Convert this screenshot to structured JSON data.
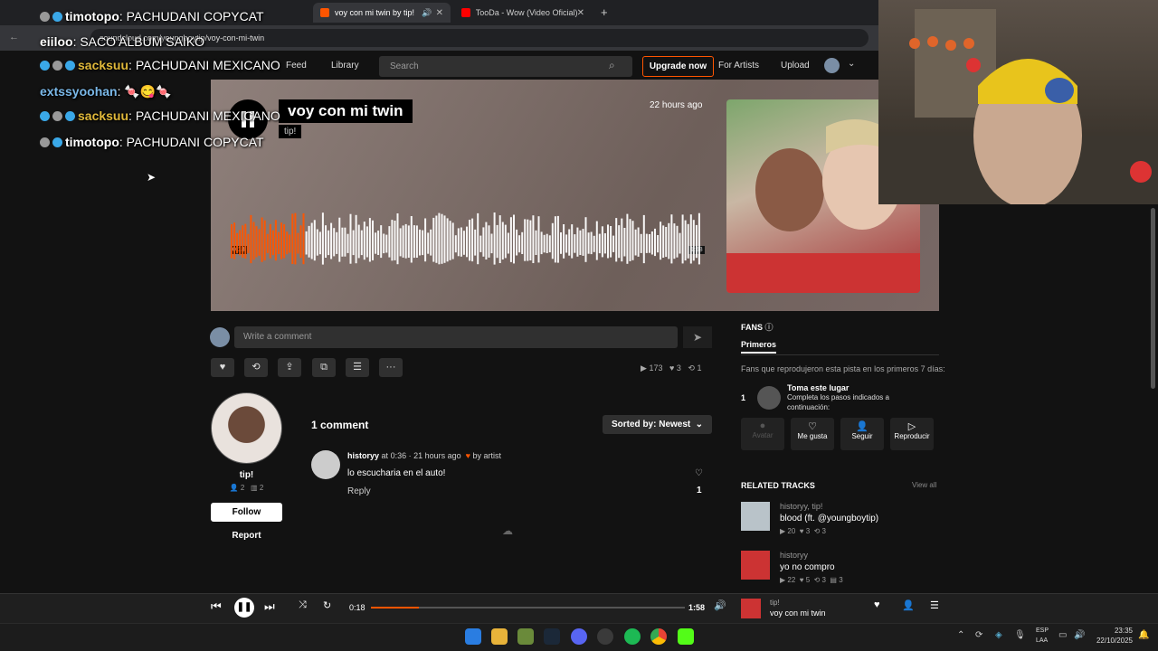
{
  "browser": {
    "tabs": [
      {
        "label": "voy con mi twin by tip!",
        "active": true,
        "favicon_color": "#ff5500"
      },
      {
        "label": "TooDa - Wow (Video Oficial) - Y",
        "active": false,
        "favicon_color": "#ff0000"
      }
    ],
    "new_tab": "+",
    "url": "soundcloud.com/youngboytip/voy-con-mi-twin"
  },
  "nav": {
    "feed": "Feed",
    "library": "Library",
    "search_placeholder": "Search",
    "upgrade": "Upgrade now",
    "for_artists": "For Artists",
    "upload": "Upload"
  },
  "track": {
    "title": "voy con mi twin",
    "artist": "tip!",
    "posted": "22 hours ago",
    "time_current": "0:18",
    "time_total": "1:58",
    "progress": 0.153,
    "accent": "#ff5500"
  },
  "comment_box": {
    "placeholder": "Write a comment",
    "send_icon": "send-icon"
  },
  "stats": {
    "plays": "173",
    "likes": "3",
    "reposts": "1"
  },
  "uploader": {
    "name": "tip!",
    "followers": "2",
    "tracks": "2",
    "follow_label": "Follow",
    "report_label": "Report"
  },
  "comments": {
    "count_label": "1 comment",
    "sort_label": "Sorted by: Newest",
    "items": [
      {
        "user": "historyy",
        "at": "at",
        "timestamp": "0:36",
        "ago": "· 21 hours ago",
        "by_artist": "by artist",
        "text": "lo escucharia en el auto!",
        "reply": "Reply",
        "likes": "1"
      }
    ]
  },
  "fans": {
    "header": "FANS",
    "tab": "Primeros",
    "description": "Fans que reprodujeron esta pista en los primeros 7 días:",
    "rank": "1",
    "slot_title": "Toma este lugar",
    "slot_desc_1": "Completa los pasos indicados a",
    "slot_desc_2": "continuación:",
    "actions": [
      "Avatar",
      "Me gusta",
      "Seguir",
      "Reproducir"
    ]
  },
  "related": {
    "header": "RELATED TRACKS",
    "view_all": "View all",
    "tracks": [
      {
        "artist": "historyy, tip!",
        "title": "blood (ft. @youngboytip)",
        "plays": "20",
        "likes": "3",
        "reposts": "3"
      },
      {
        "artist": "historyy",
        "title": "yo no compro",
        "plays": "22",
        "likes": "5",
        "reposts": "3",
        "comments": "3"
      }
    ]
  },
  "player": {
    "current": "0:18",
    "total": "1:58",
    "artist": "tip!",
    "title": "voy con mi twin"
  },
  "taskbar": {
    "lang_1": "ESP",
    "lang_2": "LAA",
    "time": "23:35",
    "date": "22/10/2025"
  },
  "chat": [
    {
      "user": "timotopo",
      "user_color": "#ffffff",
      "text": "PACHUDANI COPYCAT"
    },
    {
      "user": "eiiloo",
      "user_color": "#ffffff",
      "text": "SACO ALBUM SAIKO"
    },
    {
      "user": "sacksuu",
      "user_color": "#e0b83a",
      "text": "PACHUDANI MEXICANO"
    },
    {
      "user": "extssyoohan",
      "user_color": "#7ab8e8",
      "text": "🍬😋🍬"
    },
    {
      "user": "sacksuu",
      "user_color": "#e0b83a",
      "text": "PACHUDANI MEXICANO"
    },
    {
      "user": "timotopo",
      "user_color": "#ffffff",
      "text": "PACHUDANI COPYCAT"
    }
  ]
}
